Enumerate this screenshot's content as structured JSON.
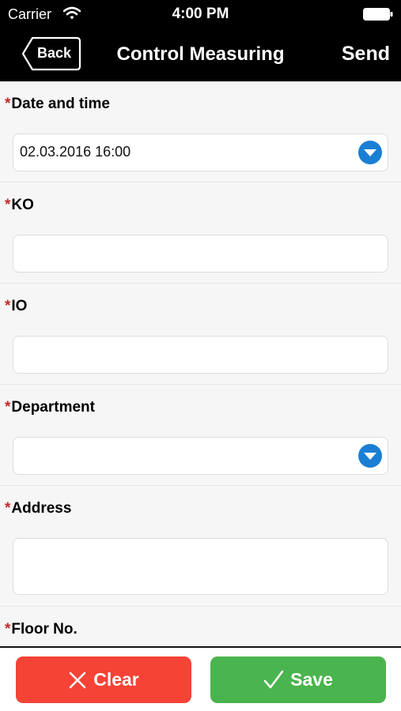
{
  "status_bar": {
    "carrier": "Carrier",
    "time": "4:00 PM"
  },
  "nav": {
    "back_label": "Back",
    "title": "Control Measuring",
    "send_label": "Send"
  },
  "form": {
    "required_mark": "*",
    "fields": [
      {
        "label": "Date and time",
        "value": "02.03.2016 16:00",
        "type": "select"
      },
      {
        "label": "KO",
        "value": "",
        "type": "text"
      },
      {
        "label": "IO",
        "value": "",
        "type": "text"
      },
      {
        "label": "Department",
        "value": "",
        "type": "select"
      },
      {
        "label": "Address",
        "value": "",
        "type": "textarea"
      },
      {
        "label": "Floor No.",
        "value": "",
        "type": "text"
      }
    ]
  },
  "actions": {
    "clear_label": "Clear",
    "save_label": "Save"
  },
  "colors": {
    "clear": "#f54336",
    "save": "#4ab44e",
    "dropdown": "#1a7fd4",
    "required": "#c62828"
  }
}
